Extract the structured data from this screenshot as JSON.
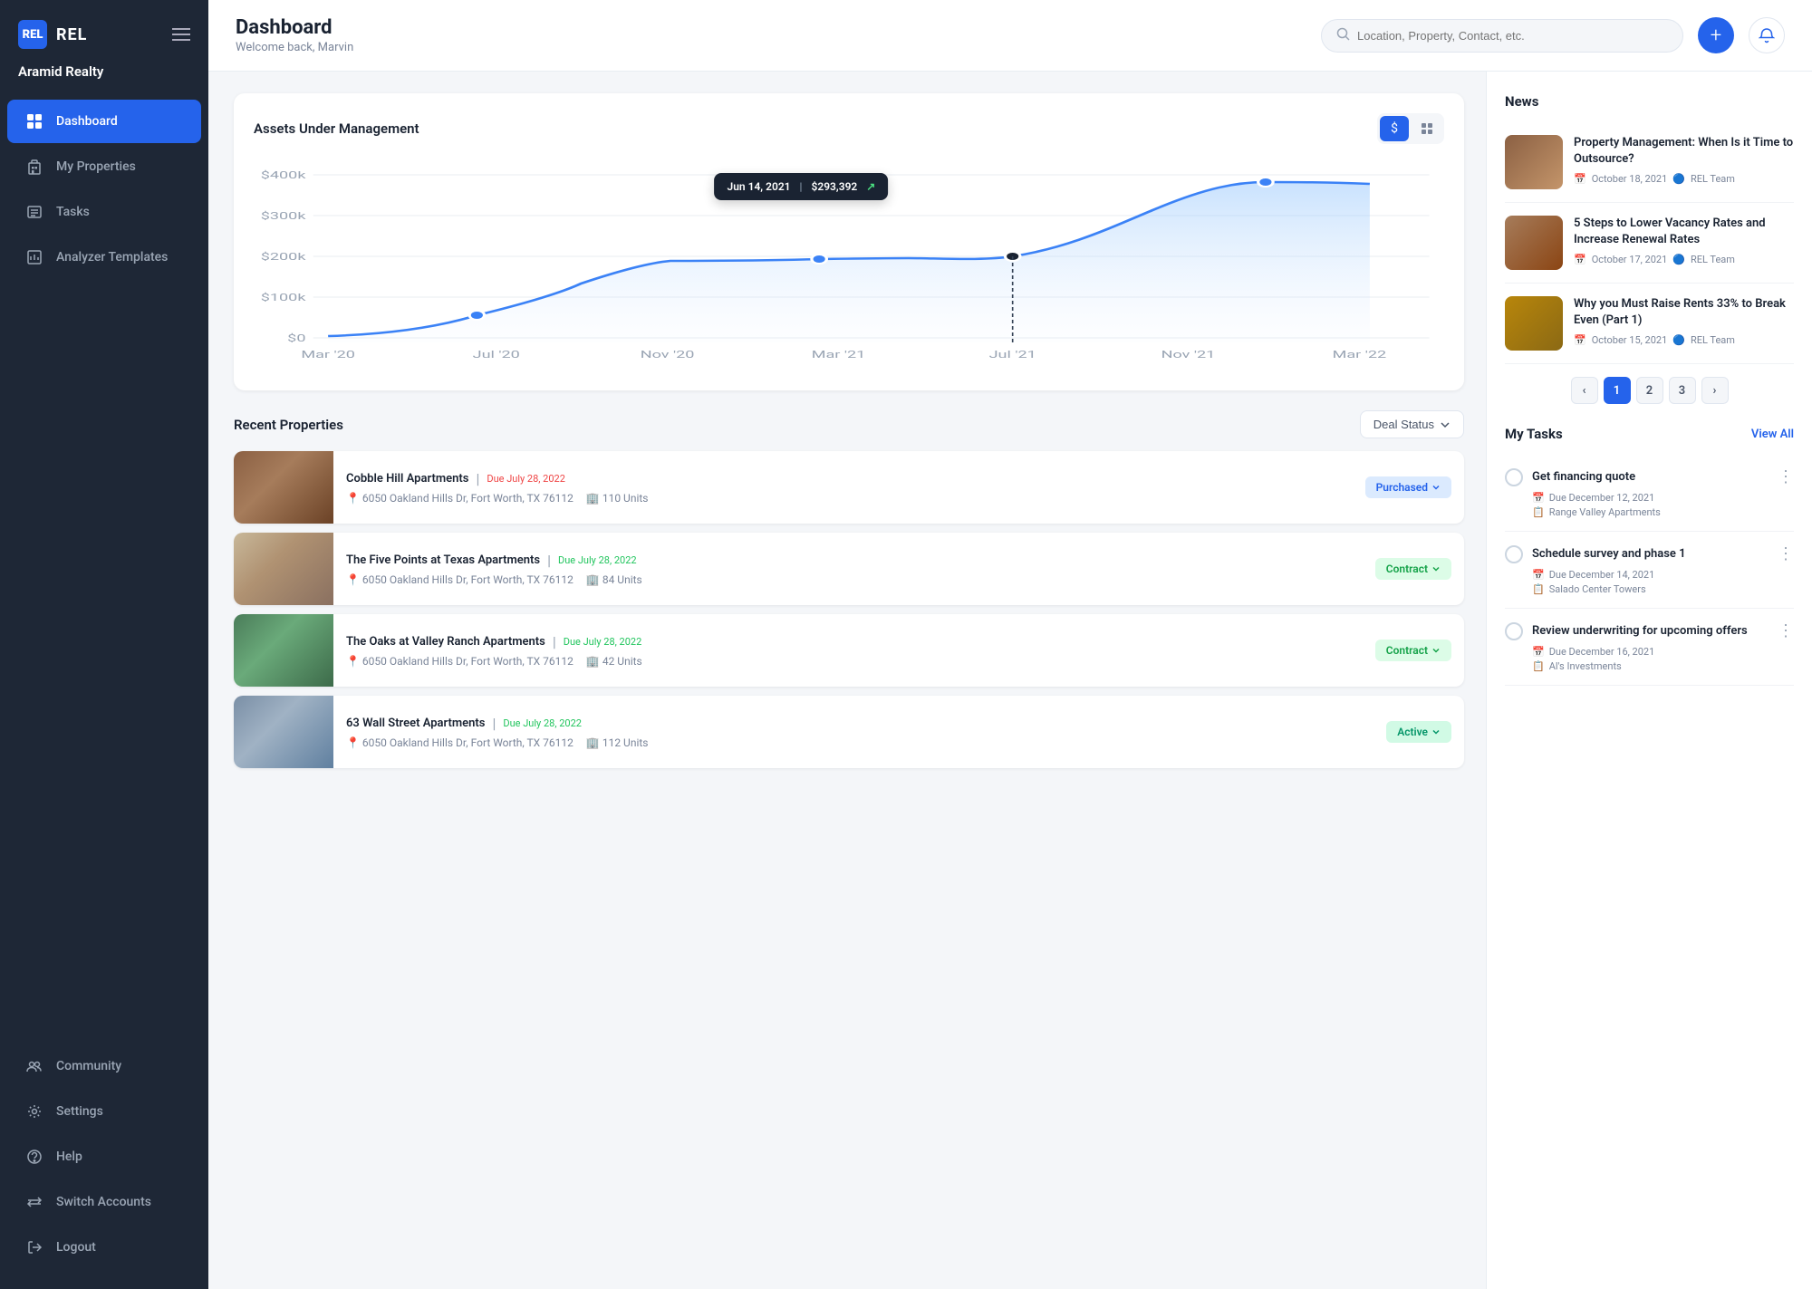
{
  "sidebar": {
    "logo_icon": "A",
    "logo_text": "REL",
    "company_name": "Aramid Realty",
    "nav_items": [
      {
        "label": "Dashboard",
        "icon": "grid",
        "active": true
      },
      {
        "label": "My Properties",
        "icon": "building",
        "active": false
      },
      {
        "label": "Tasks",
        "icon": "list",
        "active": false
      },
      {
        "label": "Analyzer Templates",
        "icon": "chart",
        "active": false
      }
    ],
    "bottom_items": [
      {
        "label": "Community",
        "icon": "users"
      },
      {
        "label": "Settings",
        "icon": "gear"
      },
      {
        "label": "Help",
        "icon": "question"
      },
      {
        "label": "Switch Accounts",
        "icon": "switch"
      },
      {
        "label": "Logout",
        "icon": "logout"
      }
    ]
  },
  "header": {
    "title": "Dashboard",
    "subtitle": "Welcome back, Marvin",
    "search_placeholder": "Location, Property, Contact, etc."
  },
  "chart": {
    "title": "Assets Under Management",
    "tooltip_date": "Jun 14, 2021",
    "tooltip_value": "$293,392",
    "y_labels": [
      "$400k",
      "$300k",
      "$200k",
      "$100k",
      "$0"
    ],
    "x_labels": [
      "Mar '20",
      "Jul '20",
      "Nov '20",
      "Mar '21",
      "Jul '21",
      "Nov '21",
      "Mar '22"
    ]
  },
  "recent_properties": {
    "title": "Recent Properties",
    "filter_label": "Deal Status",
    "items": [
      {
        "name": "Cobble Hill Apartments",
        "due_label": "Due July 28, 2022",
        "due_color": "red",
        "address": "6050 Oakland Hills Dr, Fort Worth, TX 76112",
        "units": "110 Units",
        "badge": "Purchased",
        "badge_type": "purchased",
        "img_class": "img-brown"
      },
      {
        "name": "The Five Points at Texas Apartments",
        "due_label": "Due July 28, 2022",
        "due_color": "green",
        "address": "6050 Oakland Hills Dr, Fort Worth, TX 76112",
        "units": "84 Units",
        "badge": "Contract",
        "badge_type": "contract",
        "img_class": "img-beige"
      },
      {
        "name": "The Oaks at Valley Ranch Apartments",
        "due_label": "Due July 28, 2022",
        "due_color": "green",
        "address": "6050 Oakland Hills Dr, Fort Worth, TX 76112",
        "units": "42 Units",
        "badge": "Contract",
        "badge_type": "contract",
        "img_class": "img-green"
      },
      {
        "name": "63 Wall Street Apartments",
        "due_label": "Due July 28, 2022",
        "due_color": "green",
        "address": "6050 Oakland Hills Dr, Fort Worth, TX 76112",
        "units": "112 Units",
        "badge": "Active",
        "badge_type": "active",
        "img_class": "img-gray"
      }
    ]
  },
  "news": {
    "title": "News",
    "items": [
      {
        "headline": "Property Management: When Is it Time to Outsource?",
        "date": "October 18, 2021",
        "author": "REL Team",
        "img_class": "news-img-1"
      },
      {
        "headline": "5 Steps to Lower Vacancy Rates and Increase Renewal Rates",
        "date": "October 17, 2021",
        "author": "REL Team",
        "img_class": "news-img-2"
      },
      {
        "headline": "Why you Must Raise Rents 33% to Break Even (Part 1)",
        "date": "October 15, 2021",
        "author": "REL Team",
        "img_class": "news-img-3"
      }
    ],
    "pagination": [
      {
        "label": "‹",
        "active": false
      },
      {
        "label": "1",
        "active": true
      },
      {
        "label": "2",
        "active": false
      },
      {
        "label": "3",
        "active": false
      },
      {
        "label": "›",
        "active": false
      }
    ]
  },
  "tasks": {
    "title": "My Tasks",
    "view_all": "View All",
    "items": [
      {
        "name": "Get financing quote",
        "due": "Due December 12, 2021",
        "property": "Range Valley Apartments"
      },
      {
        "name": "Schedule survey and phase 1",
        "due": "Due December 14, 2021",
        "property": "Salado Center Towers"
      },
      {
        "name": "Review underwriting for upcoming offers",
        "due": "Due December 16, 2021",
        "property": "Al's Investments"
      }
    ]
  }
}
